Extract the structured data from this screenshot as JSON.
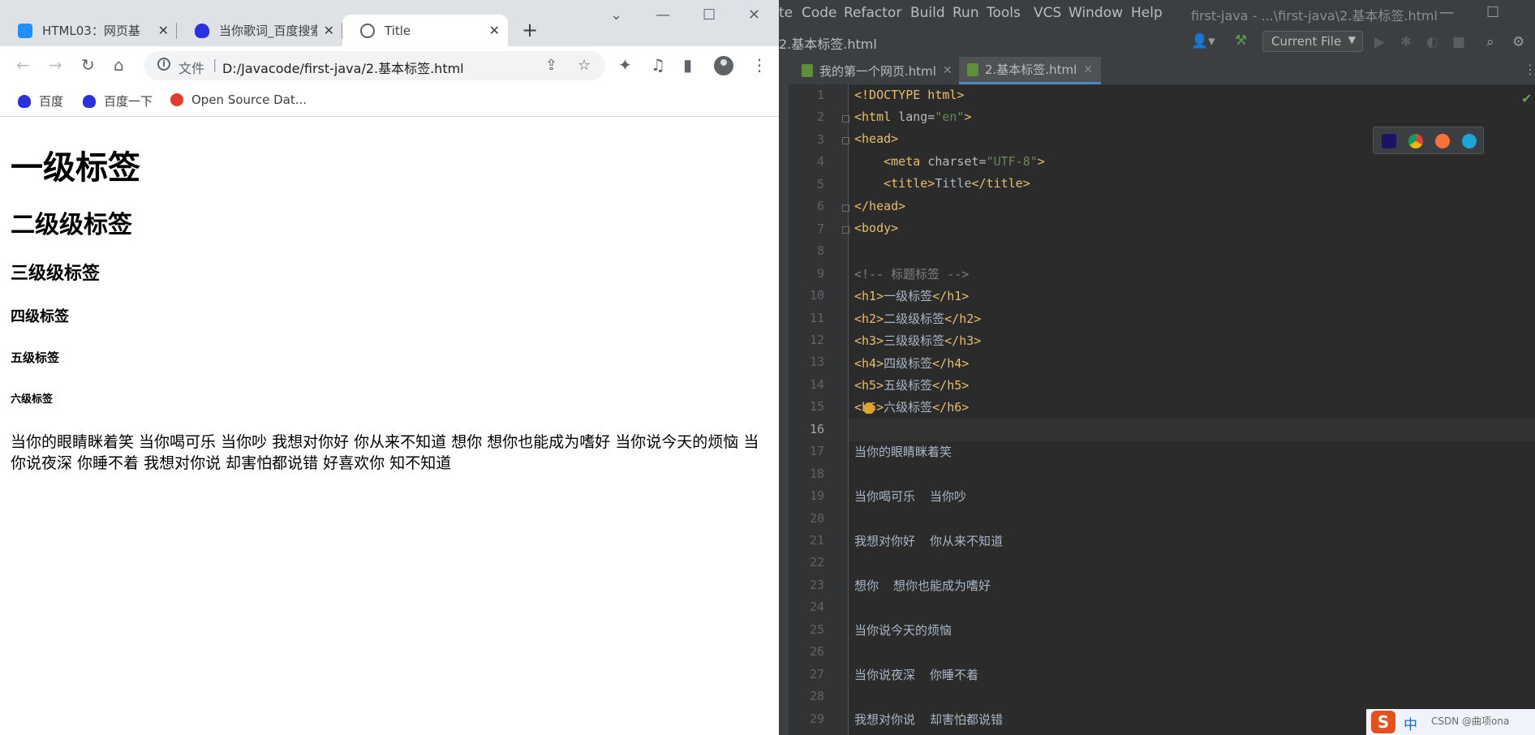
{
  "browser": {
    "tabs": [
      {
        "label": "HTML03：网页基",
        "active": false
      },
      {
        "label": "当你歌词_百度搜索",
        "active": false
      },
      {
        "label": "Title",
        "active": true
      }
    ],
    "address": {
      "file_label": "文件",
      "url": "D:/Javacode/first-java/2.基本标签.html"
    },
    "bookmarks": [
      "百度",
      "百度一下",
      "Open Source Dat..."
    ],
    "page": {
      "h1": "一级标签",
      "h2": "二级级标签",
      "h3": "三级级标签",
      "h4": "四级标签",
      "h5": "五级标签",
      "h6": "六级标签",
      "paragraph": "当你的眼睛眯着笑 当你喝可乐 当你吵 我想对你好 你从来不知道 想你 想你也能成为嗜好 当你说今天的烦恼 当你说夜深 你睡不着 我想对你说 却害怕都说错 好喜欢你 知不知道"
    }
  },
  "ide": {
    "menu": [
      "te",
      "Code",
      "Refactor",
      "Build",
      "Run",
      "Tools",
      "VCS",
      "Window",
      "Help"
    ],
    "title": "first-java - ...\\first-java\\2.基本标签.html",
    "path": "2.基本标签.html",
    "run_config": "Current File",
    "editor_tabs": [
      {
        "label": "我的第一个网页.html",
        "active": false
      },
      {
        "label": "2.基本标签.html",
        "active": true
      }
    ],
    "current_line": 16,
    "line_numbers": [
      "1",
      "2",
      "3",
      "4",
      "5",
      "6",
      "7",
      "8",
      "9",
      "10",
      "11",
      "12",
      "13",
      "14",
      "15",
      "16",
      "17",
      "18",
      "19",
      "20",
      "21",
      "22",
      "23",
      "24",
      "25",
      "26",
      "27",
      "28",
      "29"
    ],
    "code": {
      "l1": "<!DOCTYPE html>",
      "l2_tag": "<html",
      "l2_attr": "lang=",
      "l2_val": "\"en\"",
      "l2_end": ">",
      "l3": "<head>",
      "l4_tag": "<meta",
      "l4_attr": "charset=",
      "l4_val": "\"UTF-8\"",
      "l4_end": ">",
      "l5_open": "<title>",
      "l5_text": "Title",
      "l5_close": "</title>",
      "l6": "</head>",
      "l7": "<body>",
      "l9": "<!-- 标题标签 -->",
      "l10": [
        "<h1>",
        "一级标签",
        "</h1>"
      ],
      "l11": [
        "<h2>",
        "二级级标签",
        "</h2>"
      ],
      "l12": [
        "<h3>",
        "三级级标签",
        "</h3>"
      ],
      "l13": [
        "<h4>",
        "四级标签",
        "</h4>"
      ],
      "l14": [
        "<h5>",
        "五级标签",
        "</h5>"
      ],
      "l15": [
        "<h6>",
        "六级标签",
        "</h6>"
      ],
      "l17": "当你的眼睛眯着笑",
      "l19": "当你喝可乐  当你吵",
      "l21": "我想对你好  你从来不知道",
      "l23": "想你  想你也能成为嗜好",
      "l25": "当你说今天的烦恼",
      "l27": "当你说夜深  你睡不着",
      "l29": "我想对你说  却害怕都说错"
    }
  },
  "taskbar": {
    "ime_mode": "中",
    "watermark": "CSDN @曲项ona"
  },
  "colors": {
    "tag": "#e8bf6a",
    "string": "#6a8759",
    "comment": "#808080",
    "text": "#a9b7c6",
    "accent": "#4a88c7"
  }
}
